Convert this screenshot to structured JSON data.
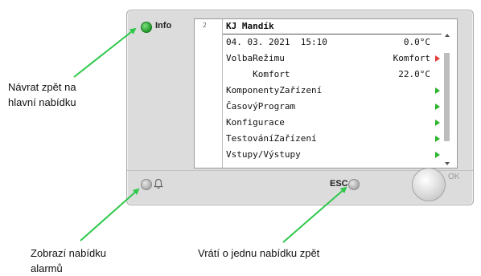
{
  "device": {
    "info_label": "Info",
    "esc_label": "ESC",
    "ok_label": "OK",
    "icons": [
      "bell-icon"
    ],
    "lcd": {
      "page_index": "2",
      "title": "KJ Mandík",
      "rows": [
        {
          "text": "04. 03. 2021  15:10",
          "value": "0.0°C",
          "arrow": ""
        },
        {
          "text": "VolbaRežimu",
          "value": "Komfort",
          "arrow": "red"
        },
        {
          "text": "     Komfort",
          "value": "22.0°C",
          "arrow": ""
        },
        {
          "text": "KomponentyZařízení",
          "value": "",
          "arrow": "green"
        },
        {
          "text": "ČasovýProgram",
          "value": "",
          "arrow": "green"
        },
        {
          "text": "Konfigurace",
          "value": "",
          "arrow": "green"
        },
        {
          "text": "TestováníZařízení",
          "value": "",
          "arrow": "green"
        },
        {
          "text": "Vstupy/Výstupy",
          "value": "",
          "arrow": "green"
        }
      ]
    },
    "colors": {
      "led": "#1f9a2a",
      "arrow_green": "#2bb52b",
      "arrow_red": "#e23b3b",
      "annotation_arrow": "#2ec84a"
    }
  },
  "annotations": {
    "info": [
      "Návrat zpět na",
      "hlavní nabídku"
    ],
    "alarm": [
      "Zobrazí nabídku",
      "alarmů"
    ],
    "esc": [
      "Vrátí o jednu nabídku zpět"
    ]
  }
}
